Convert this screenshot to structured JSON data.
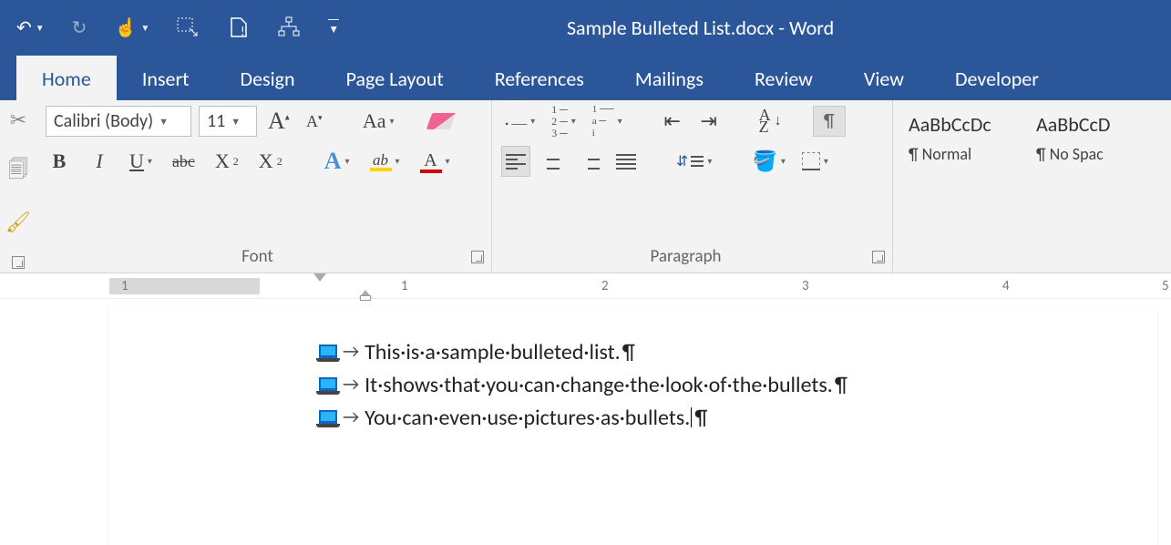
{
  "app": {
    "title": "Sample Bulleted List.docx - Word"
  },
  "tabs": {
    "home": "Home",
    "insert": "Insert",
    "design": "Design",
    "page_layout": "Page Layout",
    "references": "References",
    "mailings": "Mailings",
    "review": "Review",
    "view": "View",
    "developer": "Developer"
  },
  "font": {
    "name": "Calibri (Body)",
    "size": "11",
    "group_label": "Font",
    "bold": "B",
    "italic": "I",
    "underline": "U",
    "strike": "abc",
    "sub": "X",
    "sub_s": "2",
    "sup": "X",
    "sup_s": "2",
    "Aa": "Aa",
    "text_effects": "A",
    "highlight": "ab",
    "font_color": "A"
  },
  "paragraph": {
    "group_label": "Paragraph",
    "sort_a": "A",
    "sort_z": "Z",
    "pilcrow": "¶"
  },
  "styles": {
    "normal_sample": "AaBbCcDc",
    "normal_name": "¶ Normal",
    "nospace_sample": "AaBbCcD",
    "nospace_name": "¶ No Spac"
  },
  "ruler": {
    "n1a": "1",
    "n1": "1",
    "n2": "2",
    "n3": "3",
    "n4": "4",
    "n5": "5"
  },
  "doc": {
    "lines": [
      "This·is·a·sample·bulleted·list.",
      "It·shows·that·you·can·change·the·look·of·the·bullets.",
      "You·can·even·use·pictures·as·bullets."
    ],
    "pil": "¶",
    "tab": "→"
  }
}
